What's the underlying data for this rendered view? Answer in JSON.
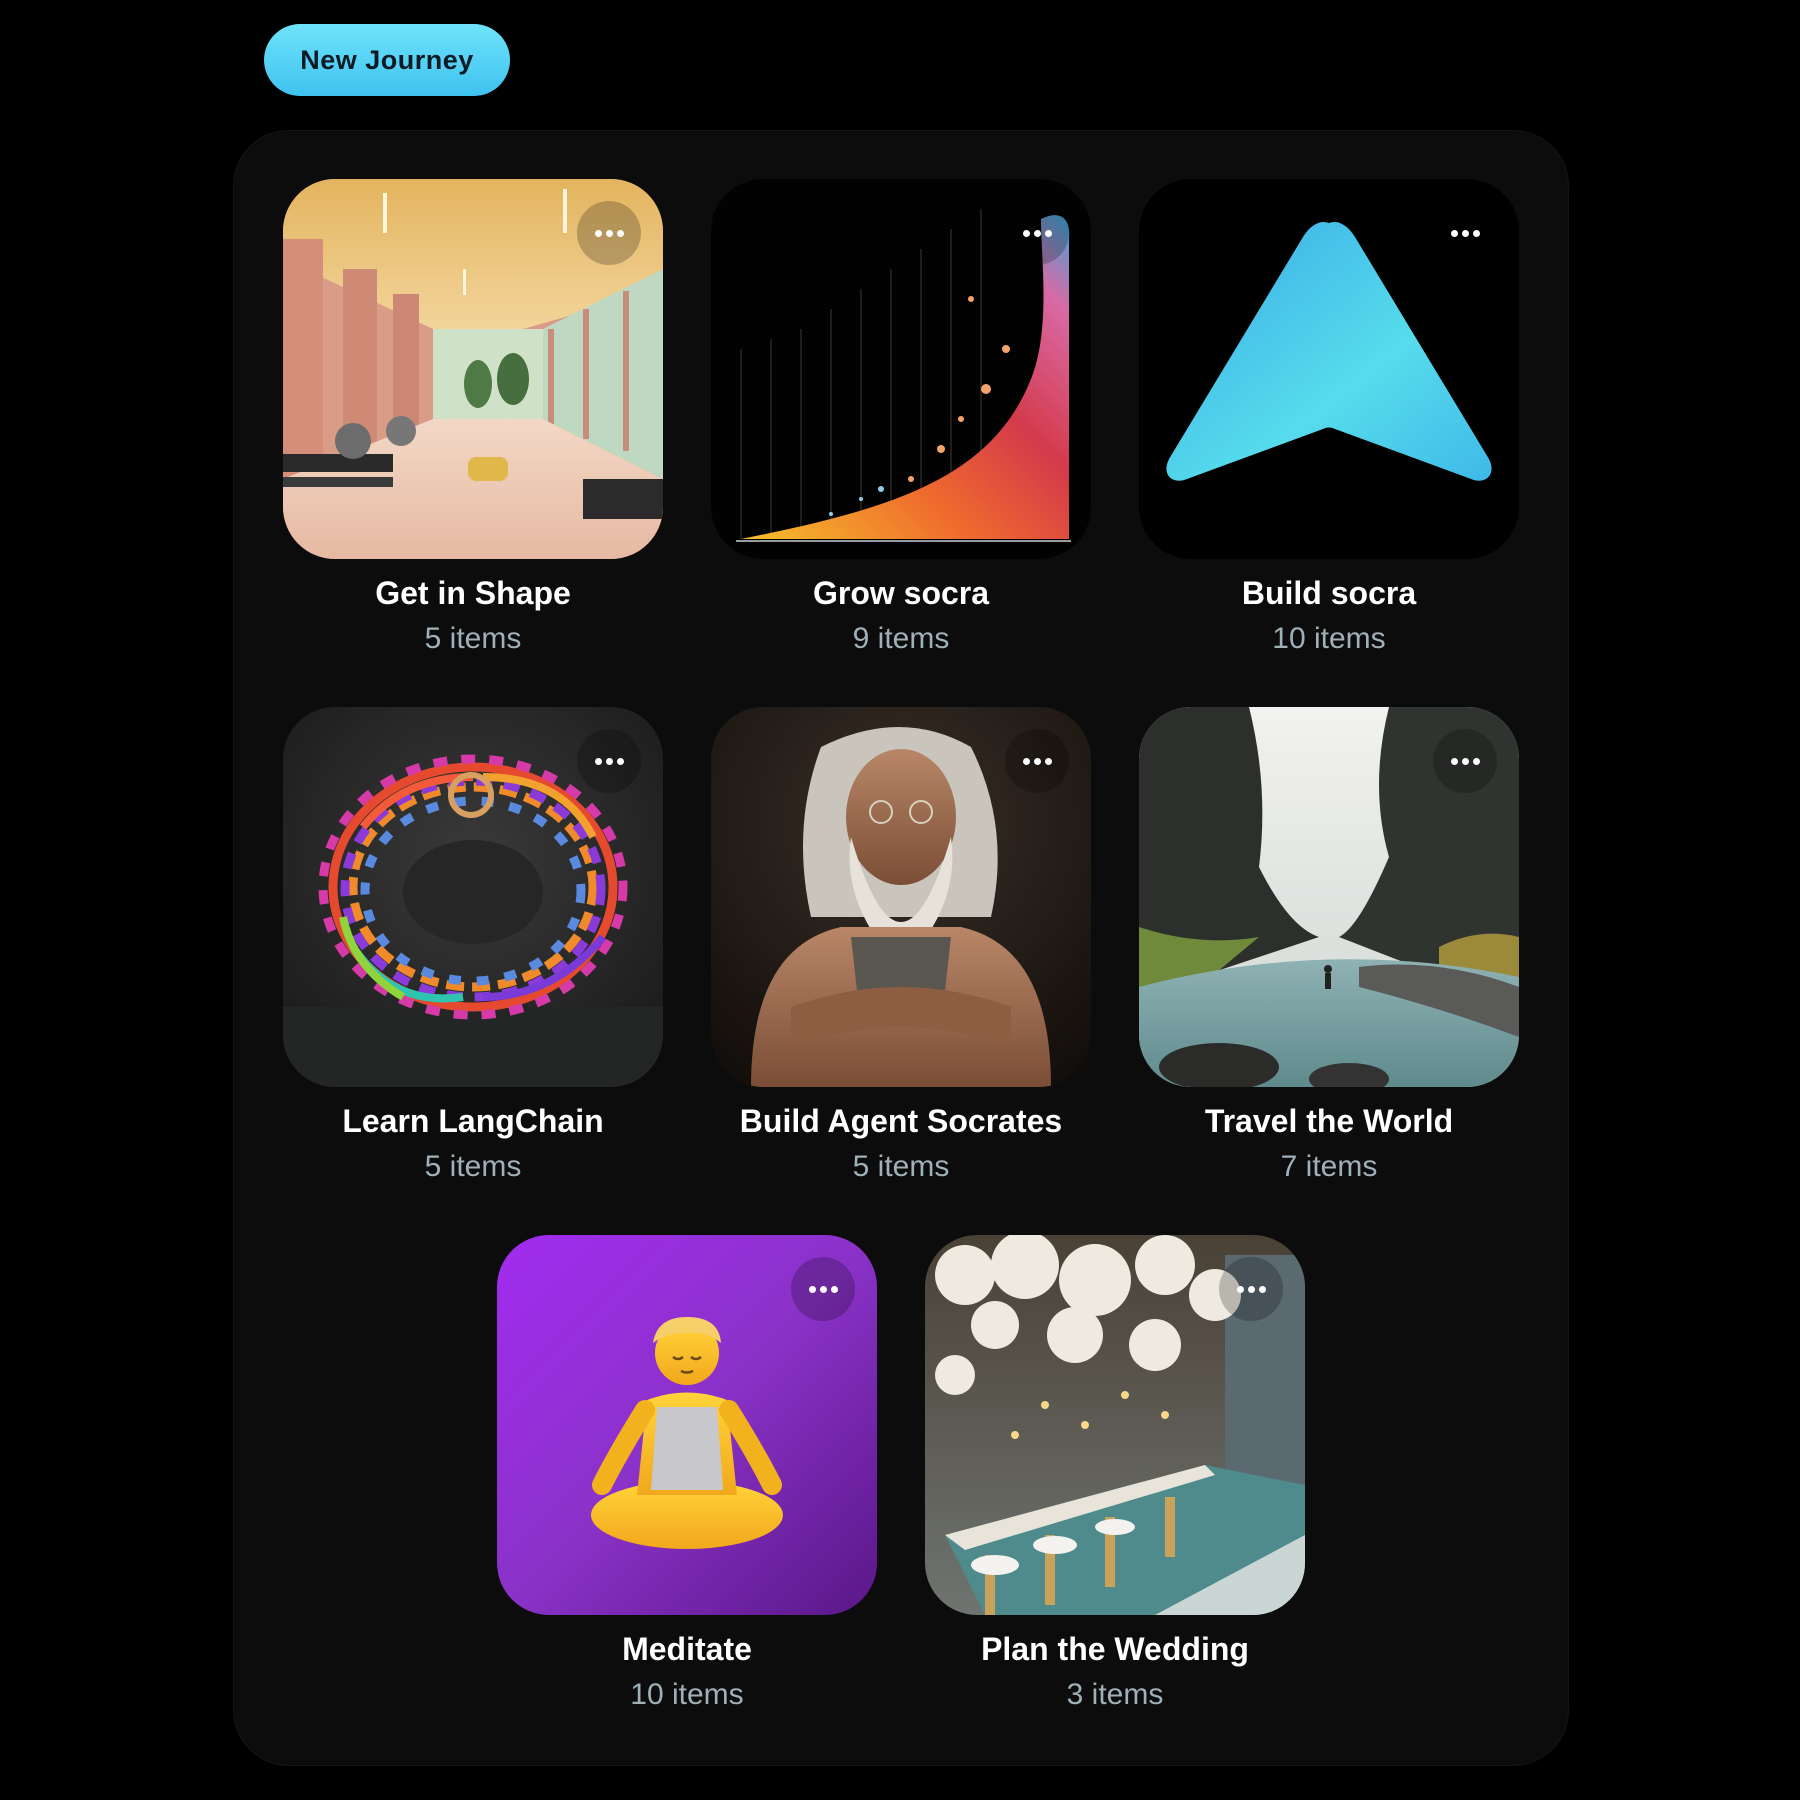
{
  "header": {
    "new_journey_label": "New Journey"
  },
  "journeys": [
    {
      "title": "Get in Shape",
      "count": "5 items",
      "thumbnail": "gym-interior-photo"
    },
    {
      "title": "Grow socra",
      "count": "9 items",
      "thumbnail": "growth-chart-graphic"
    },
    {
      "title": "Build socra",
      "count": "10 items",
      "thumbnail": "cyan-arrow-logo"
    },
    {
      "title": "Learn LangChain",
      "count": "5 items",
      "thumbnail": "rainbow-chainmail-photo"
    },
    {
      "title": "Build Agent Socrates",
      "count": "5 items",
      "thumbnail": "bearded-philosopher-portrait"
    },
    {
      "title": "Travel the World",
      "count": "7 items",
      "thumbnail": "canyon-river-landscape"
    },
    {
      "title": "Meditate",
      "count": "10 items",
      "thumbnail": "meditating-person-emoji"
    },
    {
      "title": "Plan the Wedding",
      "count": "3 items",
      "thumbnail": "wedding-banquet-hall"
    }
  ],
  "colors": {
    "background": "#000000",
    "panel": "#0c0c0c",
    "accent": "#4fd0f5",
    "meditate_purple": "#8b2be2",
    "item_count_text": "#9fb0b8"
  },
  "icons": {
    "more": "more-options-icon"
  }
}
